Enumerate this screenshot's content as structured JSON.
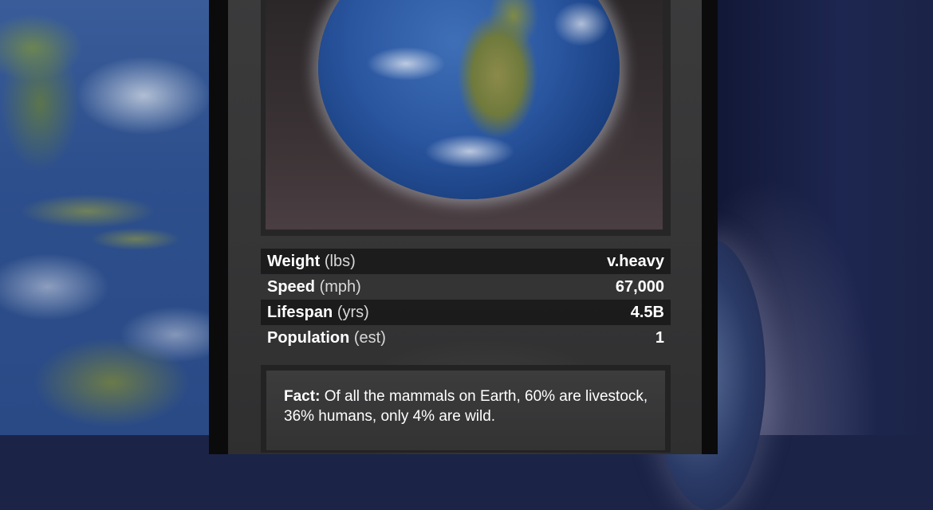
{
  "card": {
    "image_alt": "earth-globe",
    "stats": [
      {
        "label": "Weight",
        "unit": "(lbs)",
        "value": "v.heavy"
      },
      {
        "label": "Speed",
        "unit": "(mph)",
        "value": "67,000"
      },
      {
        "label": "Lifespan",
        "unit": "(yrs)",
        "value": "4.5B"
      },
      {
        "label": "Population",
        "unit": "(est)",
        "value": "1"
      }
    ],
    "fact_label": "Fact:",
    "fact_text": "Of all the mammals on Earth, 60% are livestock, 36% humans, only 4% are wild."
  },
  "colors": {
    "card_border": "#0b0b0c",
    "card_body": "#363637",
    "space": "#1b2447",
    "ocean": "#2d4f8c",
    "text": "#ffffff"
  }
}
